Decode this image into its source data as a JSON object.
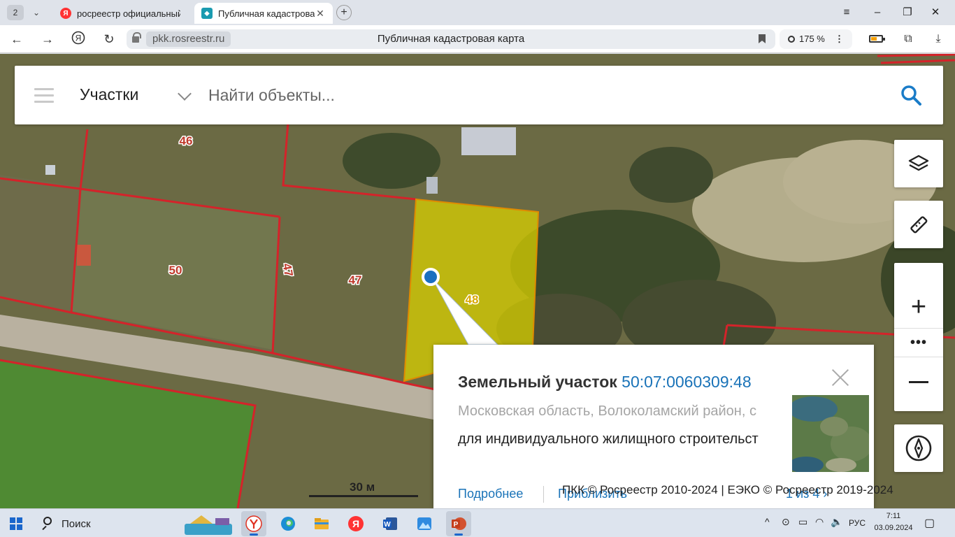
{
  "browser": {
    "tab_count": "2",
    "tabs": [
      {
        "title": "росреестр официальный",
        "active": false
      },
      {
        "title": "Публичная кадастровая",
        "active": true
      }
    ],
    "url_domain": "pkk.rosreestr.ru",
    "page_title": "Публичная кадастровая карта",
    "zoom": "175 %"
  },
  "search": {
    "category": "Участки",
    "placeholder": "Найти объекты..."
  },
  "map": {
    "parcel_labels": [
      "46",
      "50",
      "47",
      "47",
      "48"
    ],
    "scale": "30 м",
    "attribution": "ПКК © Росреестр 2010-2024 | ЕЭКО © Росреестр 2019-2024"
  },
  "popup": {
    "kind": "Земельный участок",
    "cadastral_number": "50:07:0060309:48",
    "address": "Московская область, Волоколамский район, с",
    "purpose": "для индивидуального жилищного строительст",
    "details_link": "Подробнее",
    "zoom_link": "Приблизить",
    "pager": "1 из 4"
  },
  "tools": [
    "layers-icon",
    "ruler-icon",
    "zoom-in-icon",
    "more-icon",
    "zoom-out-icon",
    "compass-icon"
  ],
  "taskbar": {
    "search_label": "Поиск",
    "lang": "РУС",
    "time": "7:11",
    "date": "03.09.2024"
  },
  "colors": {
    "parcel_border": "#d4232a",
    "selected_fill": "#d8d000",
    "link": "#1a73b8",
    "marker": "#1a6fc0"
  }
}
